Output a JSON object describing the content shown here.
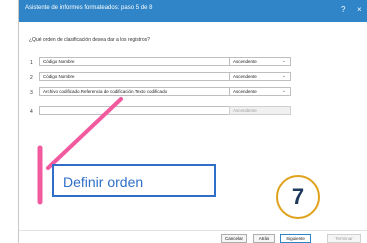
{
  "dialog": {
    "title": "Asistente de informes formateados: paso 5 de 8",
    "help_icon": "?",
    "close_icon": "×",
    "question": "¿Qué orden de clasificación desea dar a los registros?"
  },
  "sort_rows": [
    {
      "number": "1",
      "field": "Código Nombre",
      "order": "Ascendente"
    },
    {
      "number": "2",
      "field": "Código Nombre",
      "order": "Ascendente"
    },
    {
      "number": "3",
      "field": "Archivo codificado.Referencia de codificación.Texto codificado",
      "order": "Ascendente"
    },
    {
      "number": "4",
      "field": "",
      "order": "Ascendente"
    }
  ],
  "buttons": {
    "cancel": "Cancelar",
    "back": "Atrás",
    "next": "Siguiente",
    "finish": "Terminar"
  },
  "annotation": {
    "callout": "Definir orden",
    "step": "7",
    "callout_color": "#f25aa0",
    "accent_color": "#2f6fc7",
    "step_ring_color": "#e0a21b"
  },
  "icons": {
    "chevron": "⌄"
  }
}
